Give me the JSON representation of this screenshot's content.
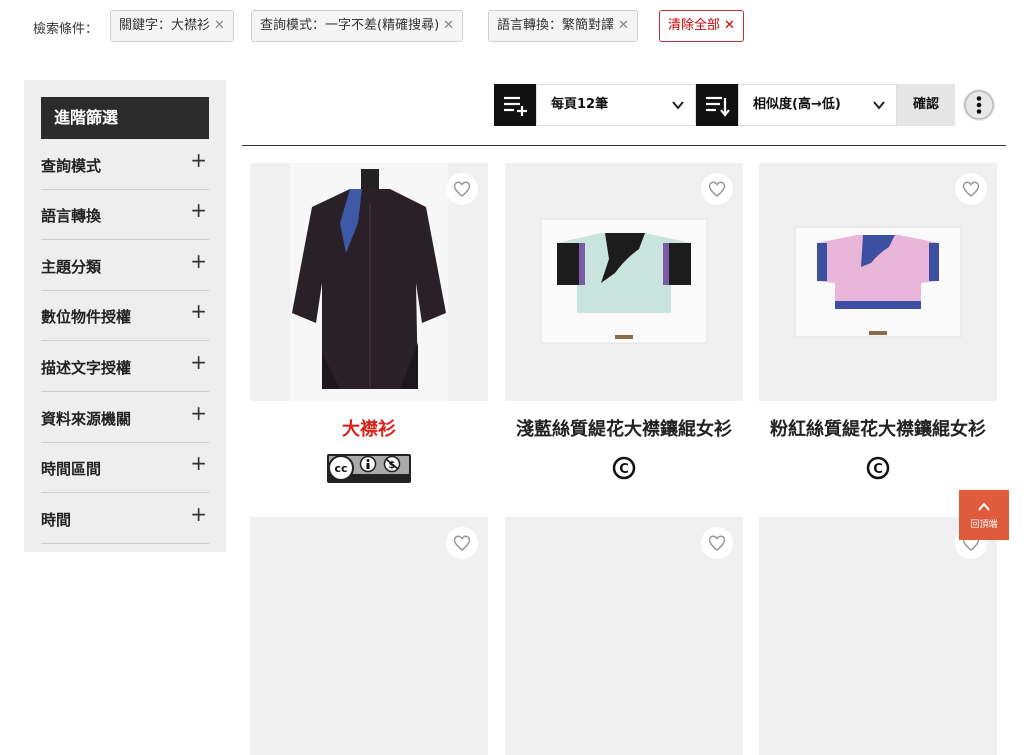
{
  "filters": {
    "label": "檢索條件：",
    "chips": [
      {
        "text": "關鍵字：大襟衫"
      },
      {
        "text": "查詢模式：一字不差(精確搜尋)"
      },
      {
        "text": "語言轉換：繁簡對譯"
      }
    ],
    "clear_label": "清除全部"
  },
  "sidebar": {
    "heading": "進階篩選",
    "items": [
      {
        "label": "查詢模式"
      },
      {
        "label": "語言轉換"
      },
      {
        "label": "主題分類"
      },
      {
        "label": "數位物件授權"
      },
      {
        "label": "描述文字授權"
      },
      {
        "label": "資料來源機關"
      },
      {
        "label": "時間區間"
      },
      {
        "label": "時間"
      }
    ]
  },
  "toolbar": {
    "per_page": "每頁12筆",
    "sort": "相似度(高→低)",
    "confirm": "確認"
  },
  "results": [
    {
      "title": "大襟衫",
      "title_color": "#d8241d",
      "license": "cc-by-nc-icon"
    },
    {
      "title": "淺藍絲質緹花大襟鑲緄女衫",
      "license": "copyright-icon"
    },
    {
      "title": "粉紅絲質緹花大襟鑲緄女衫",
      "license": "copyright-icon"
    }
  ],
  "back_to_top": "回頂端",
  "colors": {
    "accent": "#d8241d",
    "dark": "#2b2b2b",
    "back_to_top": "#e05a3c"
  }
}
